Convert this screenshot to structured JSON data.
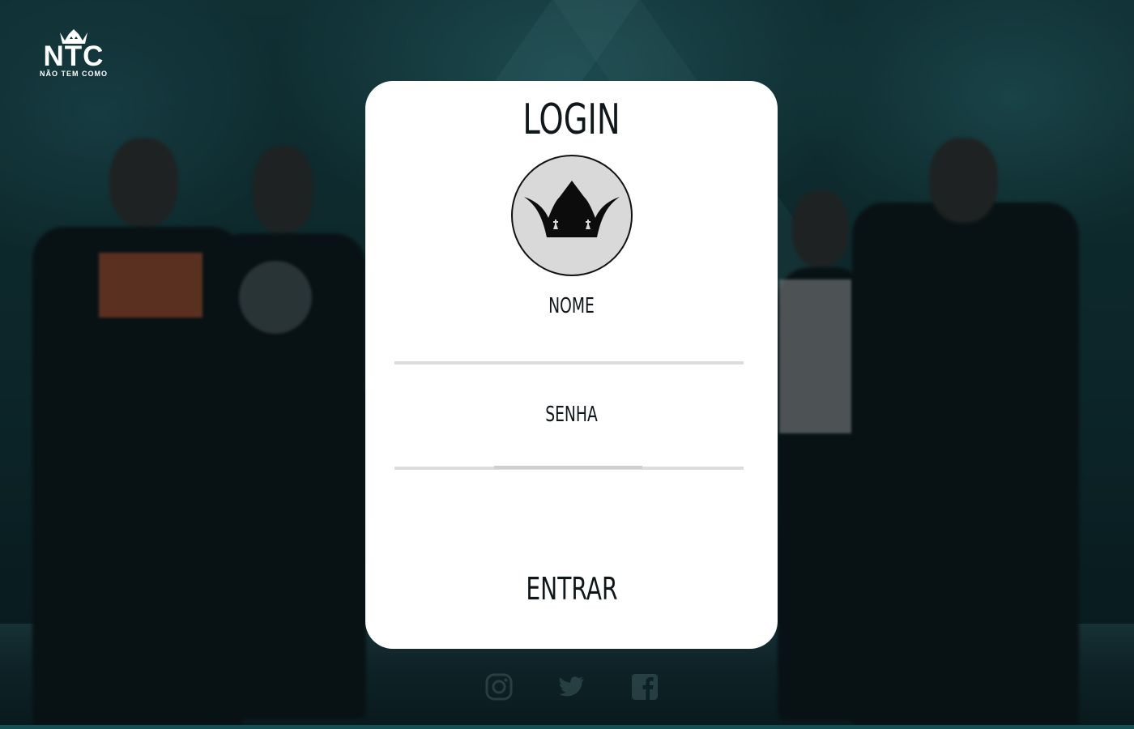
{
  "brand": {
    "name": "NTC",
    "tagline": "NÃO TEM COMO",
    "icon": "crown-icon"
  },
  "login": {
    "title": "LOGIN",
    "badge_icon": "crown-icon",
    "name_label": "NOME",
    "name_value": "",
    "password_label": "SENHA",
    "password_value": "",
    "submit_label": "ENTRAR"
  },
  "social": {
    "icons": [
      "instagram-icon",
      "twitter-icon",
      "facebook-icon"
    ]
  },
  "colors": {
    "card_background": "#ffffff",
    "text": "#10171a",
    "input_underline": "#dcdcdc",
    "badge_background": "#d9d9d9",
    "page_background": "#0d2a2e",
    "accent_stripe": "#1d6f73"
  }
}
